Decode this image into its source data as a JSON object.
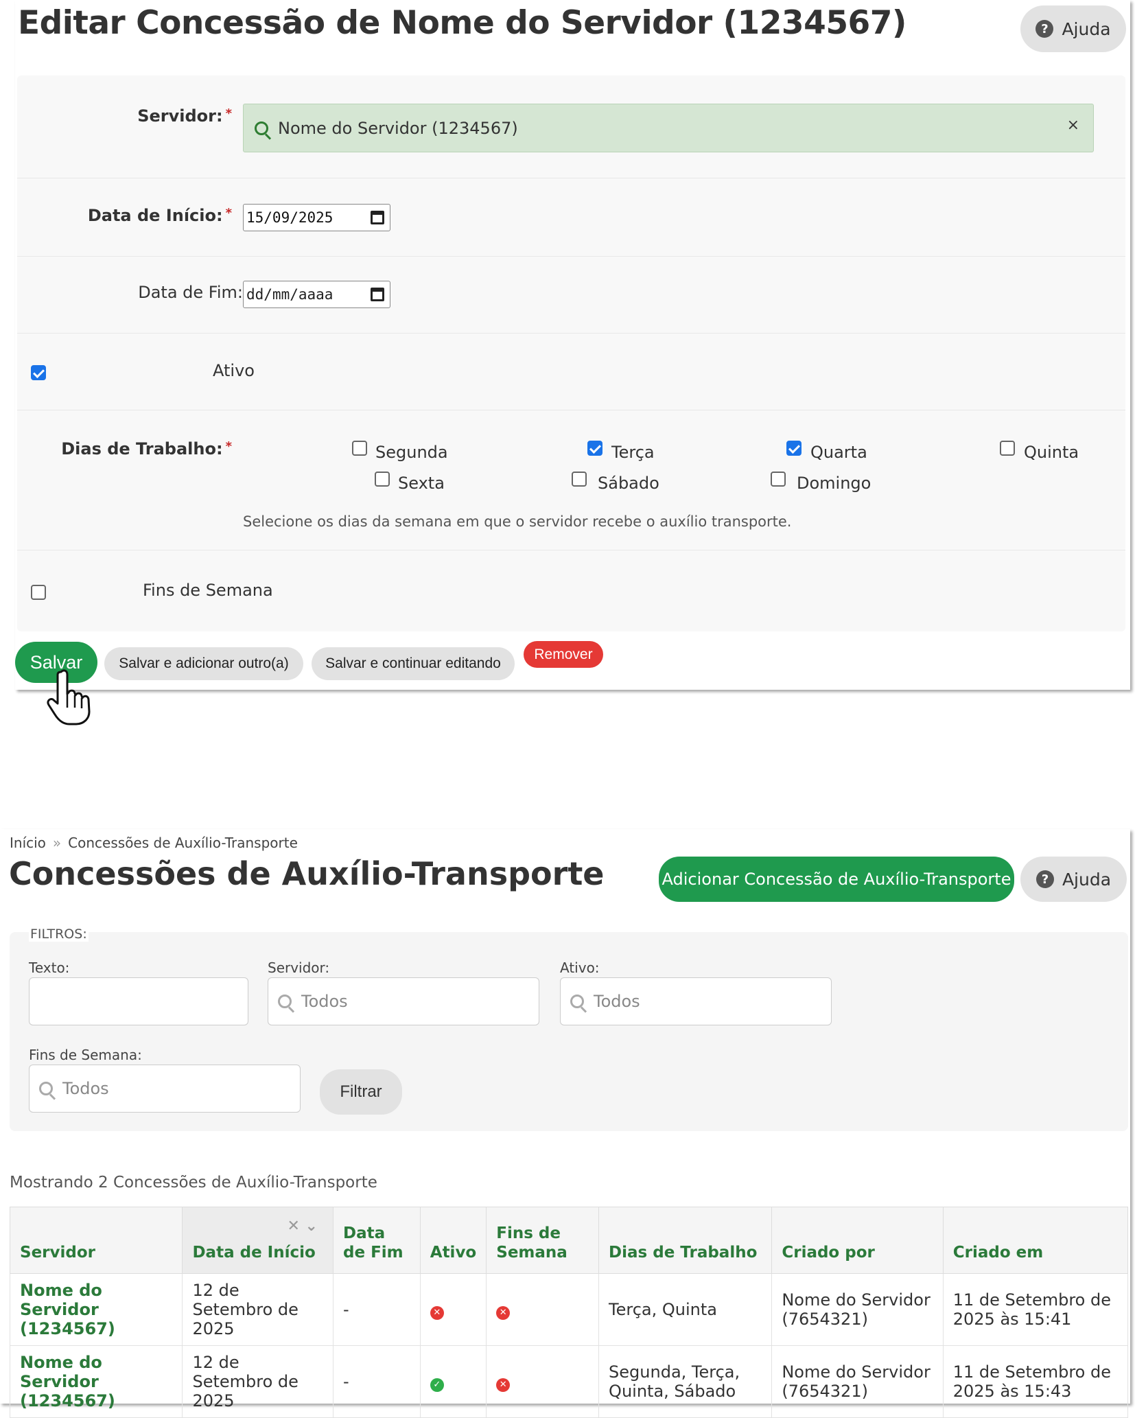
{
  "edit": {
    "title": "Editar Concessão de Nome do Servidor (1234567)",
    "help_label": "Ajuda",
    "required_mark": "*",
    "servidor": {
      "label": "Servidor:",
      "value": "Nome do Servidor (1234567)",
      "clear": "×"
    },
    "data_inicio": {
      "label": "Data de Início:",
      "value": "15/09/2025"
    },
    "data_fim": {
      "label": "Data de Fim:",
      "value": "dd/mm/aaaa"
    },
    "ativo": {
      "label": "Ativo",
      "checked": true
    },
    "dias": {
      "label": "Dias de Trabalho:",
      "items": [
        {
          "label": "Segunda",
          "checked": false
        },
        {
          "label": "Terça",
          "checked": true
        },
        {
          "label": "Quarta",
          "checked": true
        },
        {
          "label": "Quinta",
          "checked": false
        },
        {
          "label": "Sexta",
          "checked": false
        },
        {
          "label": "Sábado",
          "checked": false
        },
        {
          "label": "Domingo",
          "checked": false
        }
      ],
      "help": "Selecione os dias da semana em que o servidor recebe o auxílio transporte."
    },
    "fins_semana": {
      "label": "Fins de Semana",
      "checked": false
    },
    "buttons": {
      "save": "Salvar",
      "save_add": "Salvar e adicionar outro(a)",
      "save_continue": "Salvar e continuar editando",
      "remove": "Remover"
    }
  },
  "list": {
    "breadcrumb": {
      "home": "Início",
      "sep": "»",
      "current": "Concessões de Auxílio-Transporte"
    },
    "title": "Concessões de Auxílio-Transporte",
    "add_button": "Adicionar Concessão de Auxílio-Transporte",
    "help_label": "Ajuda",
    "filters": {
      "legend": "FILTROS:",
      "texto_label": "Texto:",
      "servidor_label": "Servidor:",
      "servidor_placeholder": "Todos",
      "ativo_label": "Ativo:",
      "ativo_placeholder": "Todos",
      "fins_label": "Fins de Semana:",
      "fins_placeholder": "Todos",
      "button": "Filtrar"
    },
    "count_text": "Mostrando 2 Concessões de Auxílio-Transporte",
    "table": {
      "headers": {
        "servidor": "Servidor",
        "data_inicio": "Data de Início",
        "data_fim": "Data de Fim",
        "ativo": "Ativo",
        "fins_semana": "Fins de Semana",
        "dias": "Dias de Trabalho",
        "criado_por": "Criado por",
        "criado_em": "Criado em"
      },
      "rows": [
        {
          "servidor": "Nome do Servidor (1234567)",
          "data_inicio": "12 de Setembro de 2025",
          "data_fim": "-",
          "ativo": false,
          "fins_semana": false,
          "dias": "Terça, Quinta",
          "criado_por": "Nome do Servidor (7654321)",
          "criado_em": "11 de Setembro de 2025 às 15:41"
        },
        {
          "servidor": "Nome do Servidor (1234567)",
          "data_inicio": "12 de Setembro de 2025",
          "data_fim": "-",
          "ativo": true,
          "fins_semana": false,
          "dias": "Segunda, Terça, Quinta, Sábado",
          "criado_por": "Nome do Servidor (7654321)",
          "criado_em": "11 de Setembro de 2025 às 15:43"
        }
      ]
    }
  },
  "colors": {
    "primary_green": "#1f9a4e",
    "link_green": "#2b7a3a",
    "danger": "#e53935",
    "selected_bg": "#d5e6d3"
  }
}
